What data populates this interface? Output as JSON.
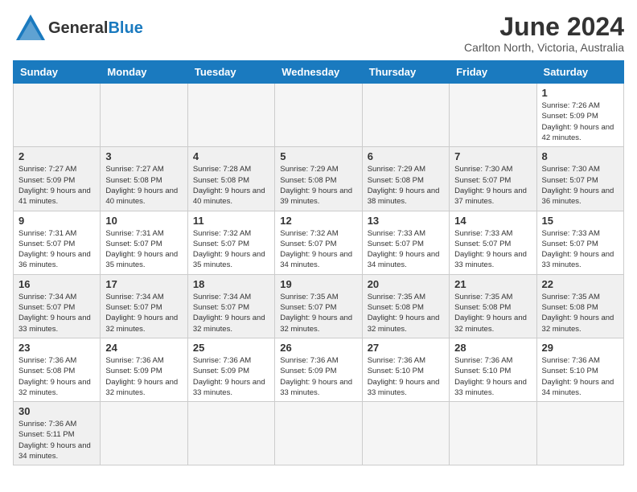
{
  "header": {
    "logo_general": "General",
    "logo_blue": "Blue",
    "month_title": "June 2024",
    "location": "Carlton North, Victoria, Australia"
  },
  "weekdays": [
    "Sunday",
    "Monday",
    "Tuesday",
    "Wednesday",
    "Thursday",
    "Friday",
    "Saturday"
  ],
  "weeks": [
    [
      {
        "day": "",
        "empty": true
      },
      {
        "day": "",
        "empty": true
      },
      {
        "day": "",
        "empty": true
      },
      {
        "day": "",
        "empty": true
      },
      {
        "day": "",
        "empty": true
      },
      {
        "day": "",
        "empty": true
      },
      {
        "day": "1",
        "sunrise": "Sunrise: 7:26 AM",
        "sunset": "Sunset: 5:09 PM",
        "daylight": "Daylight: 9 hours and 42 minutes."
      }
    ],
    [
      {
        "day": "2",
        "sunrise": "Sunrise: 7:27 AM",
        "sunset": "Sunset: 5:09 PM",
        "daylight": "Daylight: 9 hours and 41 minutes."
      },
      {
        "day": "3",
        "sunrise": "Sunrise: 7:27 AM",
        "sunset": "Sunset: 5:08 PM",
        "daylight": "Daylight: 9 hours and 40 minutes."
      },
      {
        "day": "4",
        "sunrise": "Sunrise: 7:28 AM",
        "sunset": "Sunset: 5:08 PM",
        "daylight": "Daylight: 9 hours and 40 minutes."
      },
      {
        "day": "5",
        "sunrise": "Sunrise: 7:29 AM",
        "sunset": "Sunset: 5:08 PM",
        "daylight": "Daylight: 9 hours and 39 minutes."
      },
      {
        "day": "6",
        "sunrise": "Sunrise: 7:29 AM",
        "sunset": "Sunset: 5:08 PM",
        "daylight": "Daylight: 9 hours and 38 minutes."
      },
      {
        "day": "7",
        "sunrise": "Sunrise: 7:30 AM",
        "sunset": "Sunset: 5:07 PM",
        "daylight": "Daylight: 9 hours and 37 minutes."
      },
      {
        "day": "8",
        "sunrise": "Sunrise: 7:30 AM",
        "sunset": "Sunset: 5:07 PM",
        "daylight": "Daylight: 9 hours and 36 minutes."
      }
    ],
    [
      {
        "day": "9",
        "sunrise": "Sunrise: 7:31 AM",
        "sunset": "Sunset: 5:07 PM",
        "daylight": "Daylight: 9 hours and 36 minutes."
      },
      {
        "day": "10",
        "sunrise": "Sunrise: 7:31 AM",
        "sunset": "Sunset: 5:07 PM",
        "daylight": "Daylight: 9 hours and 35 minutes."
      },
      {
        "day": "11",
        "sunrise": "Sunrise: 7:32 AM",
        "sunset": "Sunset: 5:07 PM",
        "daylight": "Daylight: 9 hours and 35 minutes."
      },
      {
        "day": "12",
        "sunrise": "Sunrise: 7:32 AM",
        "sunset": "Sunset: 5:07 PM",
        "daylight": "Daylight: 9 hours and 34 minutes."
      },
      {
        "day": "13",
        "sunrise": "Sunrise: 7:33 AM",
        "sunset": "Sunset: 5:07 PM",
        "daylight": "Daylight: 9 hours and 34 minutes."
      },
      {
        "day": "14",
        "sunrise": "Sunrise: 7:33 AM",
        "sunset": "Sunset: 5:07 PM",
        "daylight": "Daylight: 9 hours and 33 minutes."
      },
      {
        "day": "15",
        "sunrise": "Sunrise: 7:33 AM",
        "sunset": "Sunset: 5:07 PM",
        "daylight": "Daylight: 9 hours and 33 minutes."
      }
    ],
    [
      {
        "day": "16",
        "sunrise": "Sunrise: 7:34 AM",
        "sunset": "Sunset: 5:07 PM",
        "daylight": "Daylight: 9 hours and 33 minutes."
      },
      {
        "day": "17",
        "sunrise": "Sunrise: 7:34 AM",
        "sunset": "Sunset: 5:07 PM",
        "daylight": "Daylight: 9 hours and 32 minutes."
      },
      {
        "day": "18",
        "sunrise": "Sunrise: 7:34 AM",
        "sunset": "Sunset: 5:07 PM",
        "daylight": "Daylight: 9 hours and 32 minutes."
      },
      {
        "day": "19",
        "sunrise": "Sunrise: 7:35 AM",
        "sunset": "Sunset: 5:07 PM",
        "daylight": "Daylight: 9 hours and 32 minutes."
      },
      {
        "day": "20",
        "sunrise": "Sunrise: 7:35 AM",
        "sunset": "Sunset: 5:08 PM",
        "daylight": "Daylight: 9 hours and 32 minutes."
      },
      {
        "day": "21",
        "sunrise": "Sunrise: 7:35 AM",
        "sunset": "Sunset: 5:08 PM",
        "daylight": "Daylight: 9 hours and 32 minutes."
      },
      {
        "day": "22",
        "sunrise": "Sunrise: 7:35 AM",
        "sunset": "Sunset: 5:08 PM",
        "daylight": "Daylight: 9 hours and 32 minutes."
      }
    ],
    [
      {
        "day": "23",
        "sunrise": "Sunrise: 7:36 AM",
        "sunset": "Sunset: 5:08 PM",
        "daylight": "Daylight: 9 hours and 32 minutes."
      },
      {
        "day": "24",
        "sunrise": "Sunrise: 7:36 AM",
        "sunset": "Sunset: 5:09 PM",
        "daylight": "Daylight: 9 hours and 32 minutes."
      },
      {
        "day": "25",
        "sunrise": "Sunrise: 7:36 AM",
        "sunset": "Sunset: 5:09 PM",
        "daylight": "Daylight: 9 hours and 33 minutes."
      },
      {
        "day": "26",
        "sunrise": "Sunrise: 7:36 AM",
        "sunset": "Sunset: 5:09 PM",
        "daylight": "Daylight: 9 hours and 33 minutes."
      },
      {
        "day": "27",
        "sunrise": "Sunrise: 7:36 AM",
        "sunset": "Sunset: 5:10 PM",
        "daylight": "Daylight: 9 hours and 33 minutes."
      },
      {
        "day": "28",
        "sunrise": "Sunrise: 7:36 AM",
        "sunset": "Sunset: 5:10 PM",
        "daylight": "Daylight: 9 hours and 33 minutes."
      },
      {
        "day": "29",
        "sunrise": "Sunrise: 7:36 AM",
        "sunset": "Sunset: 5:10 PM",
        "daylight": "Daylight: 9 hours and 34 minutes."
      }
    ],
    [
      {
        "day": "30",
        "sunrise": "Sunrise: 7:36 AM",
        "sunset": "Sunset: 5:11 PM",
        "daylight": "Daylight: 9 hours and 34 minutes."
      },
      {
        "day": "",
        "empty": true
      },
      {
        "day": "",
        "empty": true
      },
      {
        "day": "",
        "empty": true
      },
      {
        "day": "",
        "empty": true
      },
      {
        "day": "",
        "empty": true
      },
      {
        "day": "",
        "empty": true
      }
    ]
  ]
}
